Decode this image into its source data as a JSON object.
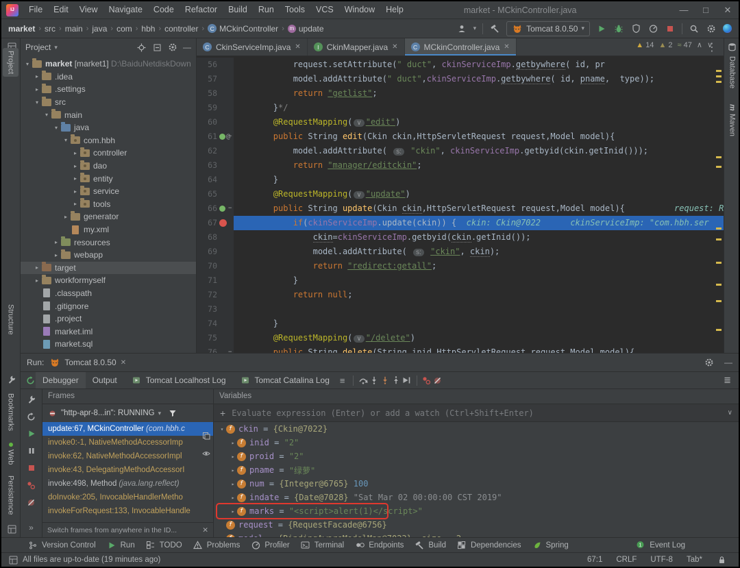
{
  "window": {
    "title": "market - MCkinController.java"
  },
  "icons": {
    "minimize": "—",
    "maximize": "□",
    "close": "✕",
    "chevron_down": "▾",
    "close_tab": "✕",
    "more_vertical": "⋮",
    "overflow": "»",
    "collapse_up": "∧",
    "collapse_down": "∨"
  },
  "menu": [
    "File",
    "Edit",
    "View",
    "Navigate",
    "Code",
    "Refactor",
    "Build",
    "Run",
    "Tools",
    "VCS",
    "Window",
    "Help"
  ],
  "crumbs": [
    {
      "label": "market",
      "cls": "b"
    },
    {
      "label": "src"
    },
    {
      "label": "main"
    },
    {
      "label": "java"
    },
    {
      "label": "com"
    },
    {
      "label": "hbh"
    },
    {
      "label": "controller"
    },
    {
      "label": "MCkinController",
      "icon": "class"
    },
    {
      "label": "update",
      "icon": "method"
    }
  ],
  "nav": {
    "run_config": "Tomcat 8.0.50"
  },
  "strips": {
    "left_top": [
      "Project",
      "Structure"
    ],
    "left_bottom": [
      "Bookmarks",
      "Web",
      "Persistence"
    ],
    "right": [
      "Database",
      "Maven"
    ]
  },
  "project": {
    "title": "Project",
    "items": [
      {
        "ind": 0,
        "arr": "v",
        "ico": "fold",
        "label": "market",
        "extra": " [market1] ",
        "path": "D:\\BaiduNetdiskDown",
        "main": true
      },
      {
        "ind": 1,
        "arr": "r",
        "ico": "fold",
        "label": ".idea"
      },
      {
        "ind": 1,
        "arr": "r",
        "ico": "fold",
        "label": ".settings"
      },
      {
        "ind": 1,
        "arr": "v",
        "ico": "fold",
        "label": "src"
      },
      {
        "ind": 2,
        "arr": "v",
        "ico": "fold",
        "label": "main"
      },
      {
        "ind": 3,
        "arr": "v",
        "ico": "src",
        "label": "java"
      },
      {
        "ind": 4,
        "arr": "v",
        "ico": "pkg",
        "label": "com.hbh"
      },
      {
        "ind": 5,
        "arr": "r",
        "ico": "pkg",
        "label": "controller"
      },
      {
        "ind": 5,
        "arr": "r",
        "ico": "pkg",
        "label": "dao"
      },
      {
        "ind": 5,
        "arr": "r",
        "ico": "pkg",
        "label": "entity"
      },
      {
        "ind": 5,
        "arr": "r",
        "ico": "pkg",
        "label": "service"
      },
      {
        "ind": 5,
        "arr": "r",
        "ico": "pkg",
        "label": "tools"
      },
      {
        "ind": 4,
        "arr": "r",
        "ico": "fold",
        "label": "generator"
      },
      {
        "ind": 4,
        "arr": "",
        "ico": "xml",
        "label": "my.xml"
      },
      {
        "ind": 3,
        "arr": "r",
        "ico": "res",
        "label": "resources"
      },
      {
        "ind": 3,
        "arr": "r",
        "ico": "fold",
        "label": "webapp"
      },
      {
        "ind": 1,
        "arr": "r",
        "ico": "ex",
        "label": "target",
        "hl": true
      },
      {
        "ind": 1,
        "arr": "r",
        "ico": "fold",
        "label": "workformyself"
      },
      {
        "ind": 1,
        "arr": "",
        "ico": "file",
        "label": ".classpath"
      },
      {
        "ind": 1,
        "arr": "",
        "ico": "file",
        "label": ".gitignore"
      },
      {
        "ind": 1,
        "arr": "",
        "ico": "file",
        "label": ".project"
      },
      {
        "ind": 1,
        "arr": "",
        "ico": "iml",
        "label": "market.iml"
      },
      {
        "ind": 1,
        "arr": "",
        "ico": "sql",
        "label": "market.sql"
      }
    ]
  },
  "editor": {
    "tabs": [
      {
        "label": "CkinServiceImp.java",
        "kind": "c"
      },
      {
        "label": "CkinMapper.java",
        "kind": "i"
      },
      {
        "label": "MCkinController.java",
        "kind": "c",
        "active": true
      }
    ],
    "inspections": {
      "warn": "14",
      "weak": "2",
      "spell": "47"
    },
    "lines": [
      {
        "n": 56,
        "s": [
          [
            "pl",
            "            request.setAttribute("
          ],
          [
            "str",
            "\" duct\""
          ],
          [
            "pl",
            ", "
          ],
          [
            "fld",
            "ckinServiceImp"
          ],
          [
            "pl",
            "."
          ],
          [
            "plu",
            "getbywhere"
          ],
          [
            "pl",
            "( id, pr"
          ]
        ]
      },
      {
        "n": 57,
        "s": [
          [
            "pl",
            "            model.addAttribute("
          ],
          [
            "str",
            "\" duct\""
          ],
          [
            "pl",
            ","
          ],
          [
            "fld",
            "ckinServiceImp"
          ],
          [
            "pl",
            "."
          ],
          [
            "plu",
            "getbywhere"
          ],
          [
            "pl",
            "( id, "
          ],
          [
            "plu",
            "pname"
          ],
          [
            "pl",
            ",  type));"
          ]
        ]
      },
      {
        "n": 58,
        "s": [
          [
            "pl",
            "            "
          ],
          [
            "kw",
            "return "
          ],
          [
            "stru",
            "\"getlist\""
          ],
          [
            "pl",
            ";"
          ]
        ]
      },
      {
        "n": 59,
        "s": [
          [
            "pl",
            "        }"
          ],
          [
            "cm",
            "*/"
          ]
        ]
      },
      {
        "n": 60,
        "s": [
          [
            "pl",
            "        "
          ],
          [
            "ann",
            "@RequestMapping"
          ],
          [
            "pl",
            "("
          ],
          [
            "chip",
            "∨"
          ],
          [
            "stru",
            "\"edit\""
          ],
          [
            "pl",
            ")"
          ]
        ]
      },
      {
        "n": 61,
        "fold": true,
        "ico": [
          "spring",
          "at"
        ],
        "s": [
          [
            "pl",
            "        "
          ],
          [
            "kw",
            "public "
          ],
          [
            "pl",
            "String "
          ],
          [
            "mth",
            "edit"
          ],
          [
            "pl",
            "(Ckin ckin,HttpServletRequest request,Model model){"
          ]
        ]
      },
      {
        "n": 62,
        "s": [
          [
            "pl",
            "            model.addAttribute( "
          ],
          [
            "chip",
            "s:"
          ],
          [
            "pl",
            " "
          ],
          [
            "str",
            "\"ckin\""
          ],
          [
            "pl",
            ", "
          ],
          [
            "fld",
            "ckinServiceImp"
          ],
          [
            "pl",
            ".getbyid(ckin.getInid()));"
          ]
        ]
      },
      {
        "n": 63,
        "s": [
          [
            "pl",
            "            "
          ],
          [
            "kw",
            "return "
          ],
          [
            "stru",
            "\"manager/editckin\""
          ],
          [
            "pl",
            ";"
          ]
        ]
      },
      {
        "n": 64,
        "s": [
          [
            "pl",
            "        }"
          ]
        ]
      },
      {
        "n": 65,
        "s": [
          [
            "pl",
            "        "
          ],
          [
            "ann",
            "@RequestMapping"
          ],
          [
            "pl",
            "("
          ],
          [
            "chip",
            "∨"
          ],
          [
            "stru",
            "\"update\""
          ],
          [
            "pl",
            ")"
          ]
        ]
      },
      {
        "n": 66,
        "fold": true,
        "ico": [
          "spring"
        ],
        "s": [
          [
            "pl",
            "        "
          ],
          [
            "kw",
            "public "
          ],
          [
            "pl",
            "String "
          ],
          [
            "mth",
            "update"
          ],
          [
            "pl",
            "(Ckin "
          ],
          [
            "plu",
            "ckin"
          ],
          [
            "pl",
            ",HttpServletRequest request,Model model){"
          ],
          [
            "dbg",
            "          request: R"
          ]
        ]
      },
      {
        "n": 67,
        "cur": true,
        "ico": [
          "bp"
        ],
        "s": [
          [
            "pl",
            "            "
          ],
          [
            "kw",
            "if"
          ],
          [
            "pl",
            "("
          ],
          [
            "fld",
            "ckinServiceImp"
          ],
          [
            "pl",
            ".update(ckin)) { "
          ],
          [
            "dbg",
            " ckin: Ckin@7022      ckinServiceImp: \"com.hbh.ser"
          ]
        ]
      },
      {
        "n": 68,
        "s": [
          [
            "pl",
            "                "
          ],
          [
            "plu",
            "ckin"
          ],
          [
            "pl",
            "="
          ],
          [
            "fld",
            "ckinServiceImp"
          ],
          [
            "pl",
            ".getbyid("
          ],
          [
            "plu",
            "ckin"
          ],
          [
            "pl",
            ".getInid());"
          ]
        ]
      },
      {
        "n": 69,
        "s": [
          [
            "pl",
            "                model.addAttribute( "
          ],
          [
            "chip",
            "s:"
          ],
          [
            "pl",
            " "
          ],
          [
            "stru",
            "\"ckin\""
          ],
          [
            "pl",
            ", "
          ],
          [
            "plu",
            "ckin"
          ],
          [
            "pl",
            ");"
          ]
        ]
      },
      {
        "n": 70,
        "s": [
          [
            "pl",
            "                "
          ],
          [
            "kw",
            "return "
          ],
          [
            "stru",
            "\"redirect:getall\""
          ],
          [
            "pl",
            ";"
          ]
        ]
      },
      {
        "n": 71,
        "s": [
          [
            "pl",
            "            }"
          ]
        ]
      },
      {
        "n": 72,
        "s": [
          [
            "pl",
            "            "
          ],
          [
            "kw",
            "return null"
          ],
          [
            "pl",
            ";"
          ]
        ]
      },
      {
        "n": 73,
        "s": []
      },
      {
        "n": 74,
        "s": [
          [
            "pl",
            "        }"
          ]
        ]
      },
      {
        "n": 75,
        "s": [
          [
            "pl",
            "        "
          ],
          [
            "ann",
            "@RequestMapping"
          ],
          [
            "pl",
            "("
          ],
          [
            "chip",
            "∨"
          ],
          [
            "stru",
            "\"/delete\""
          ],
          [
            "pl",
            ")"
          ]
        ]
      },
      {
        "n": 76,
        "fold": true,
        "s": [
          [
            "pl",
            "        "
          ],
          [
            "kw",
            "public "
          ],
          [
            "pl",
            "String "
          ],
          [
            "mth",
            "delete"
          ],
          [
            "pl",
            "(String inid,HttpServletRequest request,Model model){"
          ]
        ]
      }
    ]
  },
  "run": {
    "label": "Run:",
    "tab": "Tomcat 8.0.50",
    "tabs": [
      "Debugger",
      "Output",
      "Tomcat Localhost Log",
      "Tomcat Catalina Log"
    ]
  },
  "frames": {
    "title": "Frames",
    "thread": "\"http-apr-8...in\": RUNNING",
    "items": [
      {
        "t": "update:67, MCkinController ",
        "s": "(com.hbh.c",
        "cls": "sel"
      },
      {
        "t": "invoke0:-1, NativeMethodAccessorImp",
        "cls": "lib"
      },
      {
        "t": "invoke:62, NativeMethodAccessorImpl",
        "cls": "lib"
      },
      {
        "t": "invoke:43, DelegatingMethodAccessorI",
        "cls": "lib"
      },
      {
        "t": "invoke:498, Method ",
        "s": "(java.lang.reflect)",
        "cls": ""
      },
      {
        "t": "doInvoke:205, InvocableHandlerMetho",
        "cls": "lib"
      },
      {
        "t": "invokeForRequest:133, InvocableHandle",
        "cls": "lib"
      }
    ],
    "tip": "Switch frames from anywhere in the ID..."
  },
  "vars": {
    "title": "Variables",
    "placeholder": "Evaluate expression (Enter) or add a watch (Ctrl+Shift+Enter)",
    "items": [
      {
        "ind": 0,
        "arr": "v",
        "name": "ckin",
        "parts": [
          [
            "o",
            "{Ckin@7022}"
          ]
        ]
      },
      {
        "ind": 1,
        "arr": "r",
        "name": "inid",
        "parts": [
          [
            "s",
            "\"2\""
          ]
        ]
      },
      {
        "ind": 1,
        "arr": "r",
        "name": "proid",
        "parts": [
          [
            "s",
            "\"2\""
          ]
        ]
      },
      {
        "ind": 1,
        "arr": "r",
        "name": "pname",
        "parts": [
          [
            "s",
            "\"绿萝\""
          ]
        ]
      },
      {
        "ind": 1,
        "arr": "r",
        "name": "num",
        "parts": [
          [
            "o",
            "{Integer@6765} "
          ],
          [
            "n",
            "100"
          ]
        ]
      },
      {
        "ind": 1,
        "arr": "r",
        "name": "indate",
        "parts": [
          [
            "o",
            "{Date@7028} "
          ],
          [
            "d",
            "\"Sat Mar 02 00:00:00 CST 2019\""
          ]
        ]
      },
      {
        "ind": 1,
        "arr": "r",
        "name": "marks",
        "parts": [
          [
            "s",
            "\"<script>alert(1)</script>\""
          ]
        ],
        "boxed": true
      },
      {
        "ind": 0,
        "arr": "",
        "name": "request",
        "parts": [
          [
            "o",
            "{RequestFacade@6756}"
          ]
        ]
      },
      {
        "ind": 0,
        "arr": "",
        "name": "model",
        "parts": [
          [
            "o",
            "{BindingAwareModelMap@7023}  size = 2"
          ]
        ]
      }
    ]
  },
  "status": {
    "items": [
      {
        "ico": "branch",
        "label": "Version Control"
      },
      {
        "ico": "play",
        "label": "Run"
      },
      {
        "ico": "todo",
        "label": "TODO"
      },
      {
        "ico": "problems",
        "label": "Problems"
      },
      {
        "ico": "profiler",
        "label": "Profiler"
      },
      {
        "ico": "terminal",
        "label": "Terminal"
      },
      {
        "ico": "endpoints",
        "label": "Endpoints"
      },
      {
        "ico": "hammer",
        "label": "Build"
      },
      {
        "ico": "deps",
        "label": "Dependencies"
      },
      {
        "ico": "leaf",
        "label": "Spring"
      }
    ],
    "event_log": "Event Log",
    "message": "All files are up-to-date (19 minutes ago)",
    "caret": "67:1",
    "eol": "CRLF",
    "enc": "UTF-8",
    "tab": "Tab*"
  }
}
